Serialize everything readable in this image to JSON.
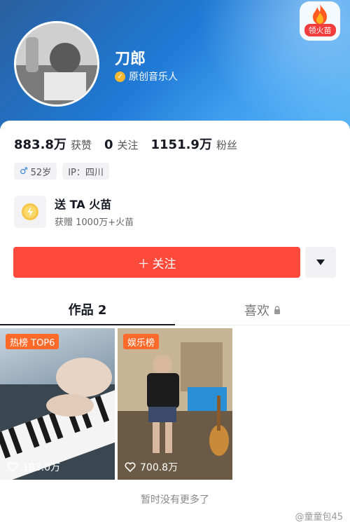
{
  "profile": {
    "name": "刀郎",
    "verified_text": "原创音乐人",
    "fire_badge_label": "领火苗"
  },
  "stats": {
    "likes_value": "883.8万",
    "likes_label": "获赞",
    "following_value": "0",
    "following_label": "关注",
    "followers_value": "1151.9万",
    "followers_label": "粉丝"
  },
  "tags": {
    "age": "52岁",
    "ip": "IP：四川"
  },
  "gift": {
    "title": "送 TA 火苗",
    "subtitle": "获赠 1000万+火苗"
  },
  "actions": {
    "follow_label": "关注"
  },
  "tabs": {
    "works_label": "作品 2",
    "likes_label": "喜欢"
  },
  "videos": [
    {
      "badge": "热榜 TOP6",
      "likes": "183.0万"
    },
    {
      "badge": "娱乐榜",
      "likes": "700.8万"
    }
  ],
  "footer": {
    "no_more": "暂时没有更多了",
    "watermark": "@童童包45"
  },
  "colors": {
    "accent": "#fe4a3b",
    "header_blue": "#1f7ad6",
    "badge_orange": "#ff6a2a"
  }
}
